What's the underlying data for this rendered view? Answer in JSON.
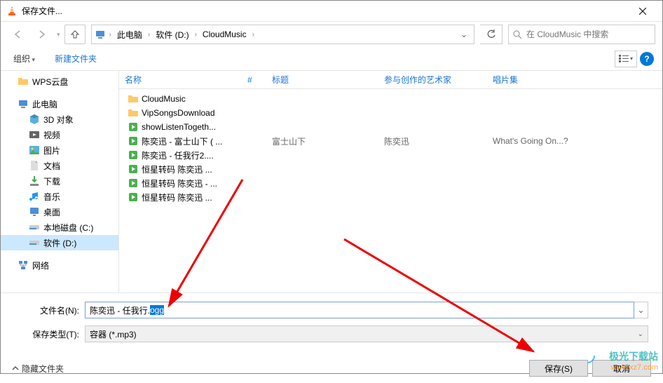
{
  "window": {
    "title": "保存文件..."
  },
  "nav": {
    "breadcrumb": [
      "此电脑",
      "软件 (D:)",
      "CloudMusic"
    ],
    "search_placeholder": "在 CloudMusic 中搜索"
  },
  "toolbar": {
    "organize": "组织",
    "newfolder": "新建文件夹"
  },
  "sidebar": {
    "wps": "WPS云盘",
    "thispc": "此电脑",
    "items": [
      "3D 对象",
      "视频",
      "图片",
      "文档",
      "下载",
      "音乐",
      "桌面",
      "本地磁盘 (C:)",
      "软件 (D:)"
    ],
    "network": "网络"
  },
  "columns": {
    "name": "名称",
    "num": "#",
    "title": "标题",
    "artist": "参与创作的艺术家",
    "album": "唱片集"
  },
  "files": [
    {
      "type": "folder",
      "name": "CloudMusic",
      "title": "",
      "artist": "",
      "album": ""
    },
    {
      "type": "folder",
      "name": "VipSongsDownload",
      "title": "",
      "artist": "",
      "album": ""
    },
    {
      "type": "audio",
      "name": "showListenTogeth...",
      "title": "",
      "artist": "",
      "album": ""
    },
    {
      "type": "audio",
      "name": "陈奕迅 - 富士山下 ( ...",
      "title": "富士山下",
      "artist": "陈奕迅",
      "album": "What's Going On...?"
    },
    {
      "type": "audio",
      "name": "陈奕迅 - 任我行2....",
      "title": "",
      "artist": "",
      "album": ""
    },
    {
      "type": "audio",
      "name": "恒星转码 陈奕迅 ...",
      "title": "",
      "artist": "",
      "album": ""
    },
    {
      "type": "audio",
      "name": "恒星转码 陈奕迅 - ...",
      "title": "",
      "artist": "",
      "album": ""
    },
    {
      "type": "audio",
      "name": "恒星转码 陈奕迅 ...",
      "title": "",
      "artist": "",
      "album": ""
    }
  ],
  "form": {
    "filename_label": "文件名(N):",
    "filename_value": "陈奕迅 - 任我行.",
    "filename_sel": "ogg",
    "type_label": "保存类型(T):",
    "type_value": "容器 (*.mp3)"
  },
  "footer": {
    "hide": "隐藏文件夹",
    "save": "保存(S)",
    "cancel": "取消"
  },
  "watermark": {
    "name": "极光下载站",
    "url": "www.xz7.com"
  }
}
